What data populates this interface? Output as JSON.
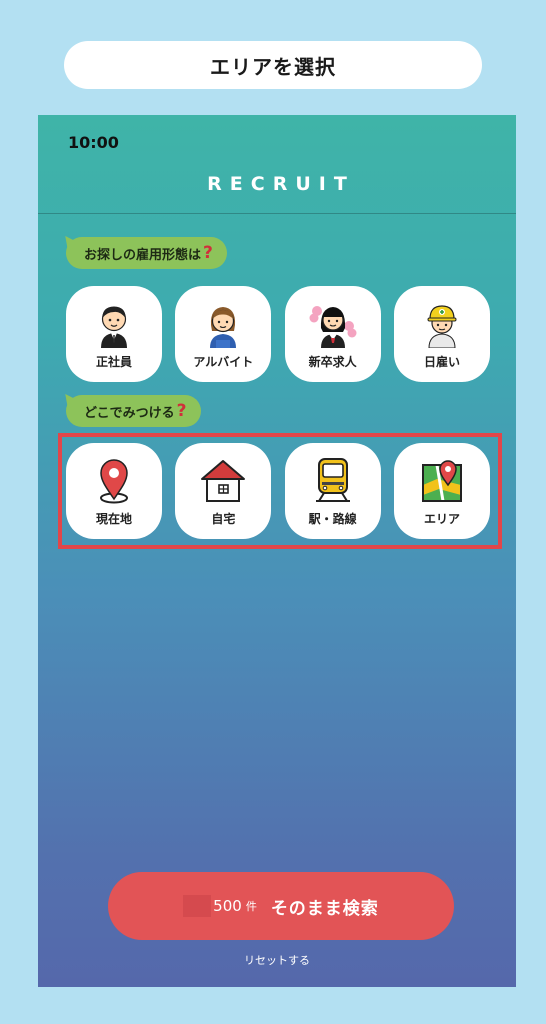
{
  "top_label": "エリアを選択",
  "status": {
    "time": "10:00"
  },
  "header": {
    "title": "RECRUIT"
  },
  "section1": {
    "prompt": "お探しの雇用形態は",
    "mark": "?",
    "items": [
      {
        "label": "正社員",
        "icon": "office-worker-icon"
      },
      {
        "label": "アルバイト",
        "icon": "part-timer-icon"
      },
      {
        "label": "新卒求人",
        "icon": "new-graduate-icon"
      },
      {
        "label": "日雇い",
        "icon": "day-laborer-icon"
      }
    ]
  },
  "section2": {
    "prompt": "どこでみつける",
    "mark": "?",
    "items": [
      {
        "label": "現在地",
        "icon": "location-pin-icon"
      },
      {
        "label": "自宅",
        "icon": "home-icon"
      },
      {
        "label": "駅・路線",
        "icon": "train-icon"
      },
      {
        "label": "エリア",
        "icon": "map-icon"
      }
    ]
  },
  "search": {
    "count": "500",
    "unit": "件",
    "label": "そのまま検索"
  },
  "reset_label": "リセットする",
  "colors": {
    "accent": "#e25456",
    "bubble": "#8dc35a",
    "highlight": "#e2464a"
  }
}
